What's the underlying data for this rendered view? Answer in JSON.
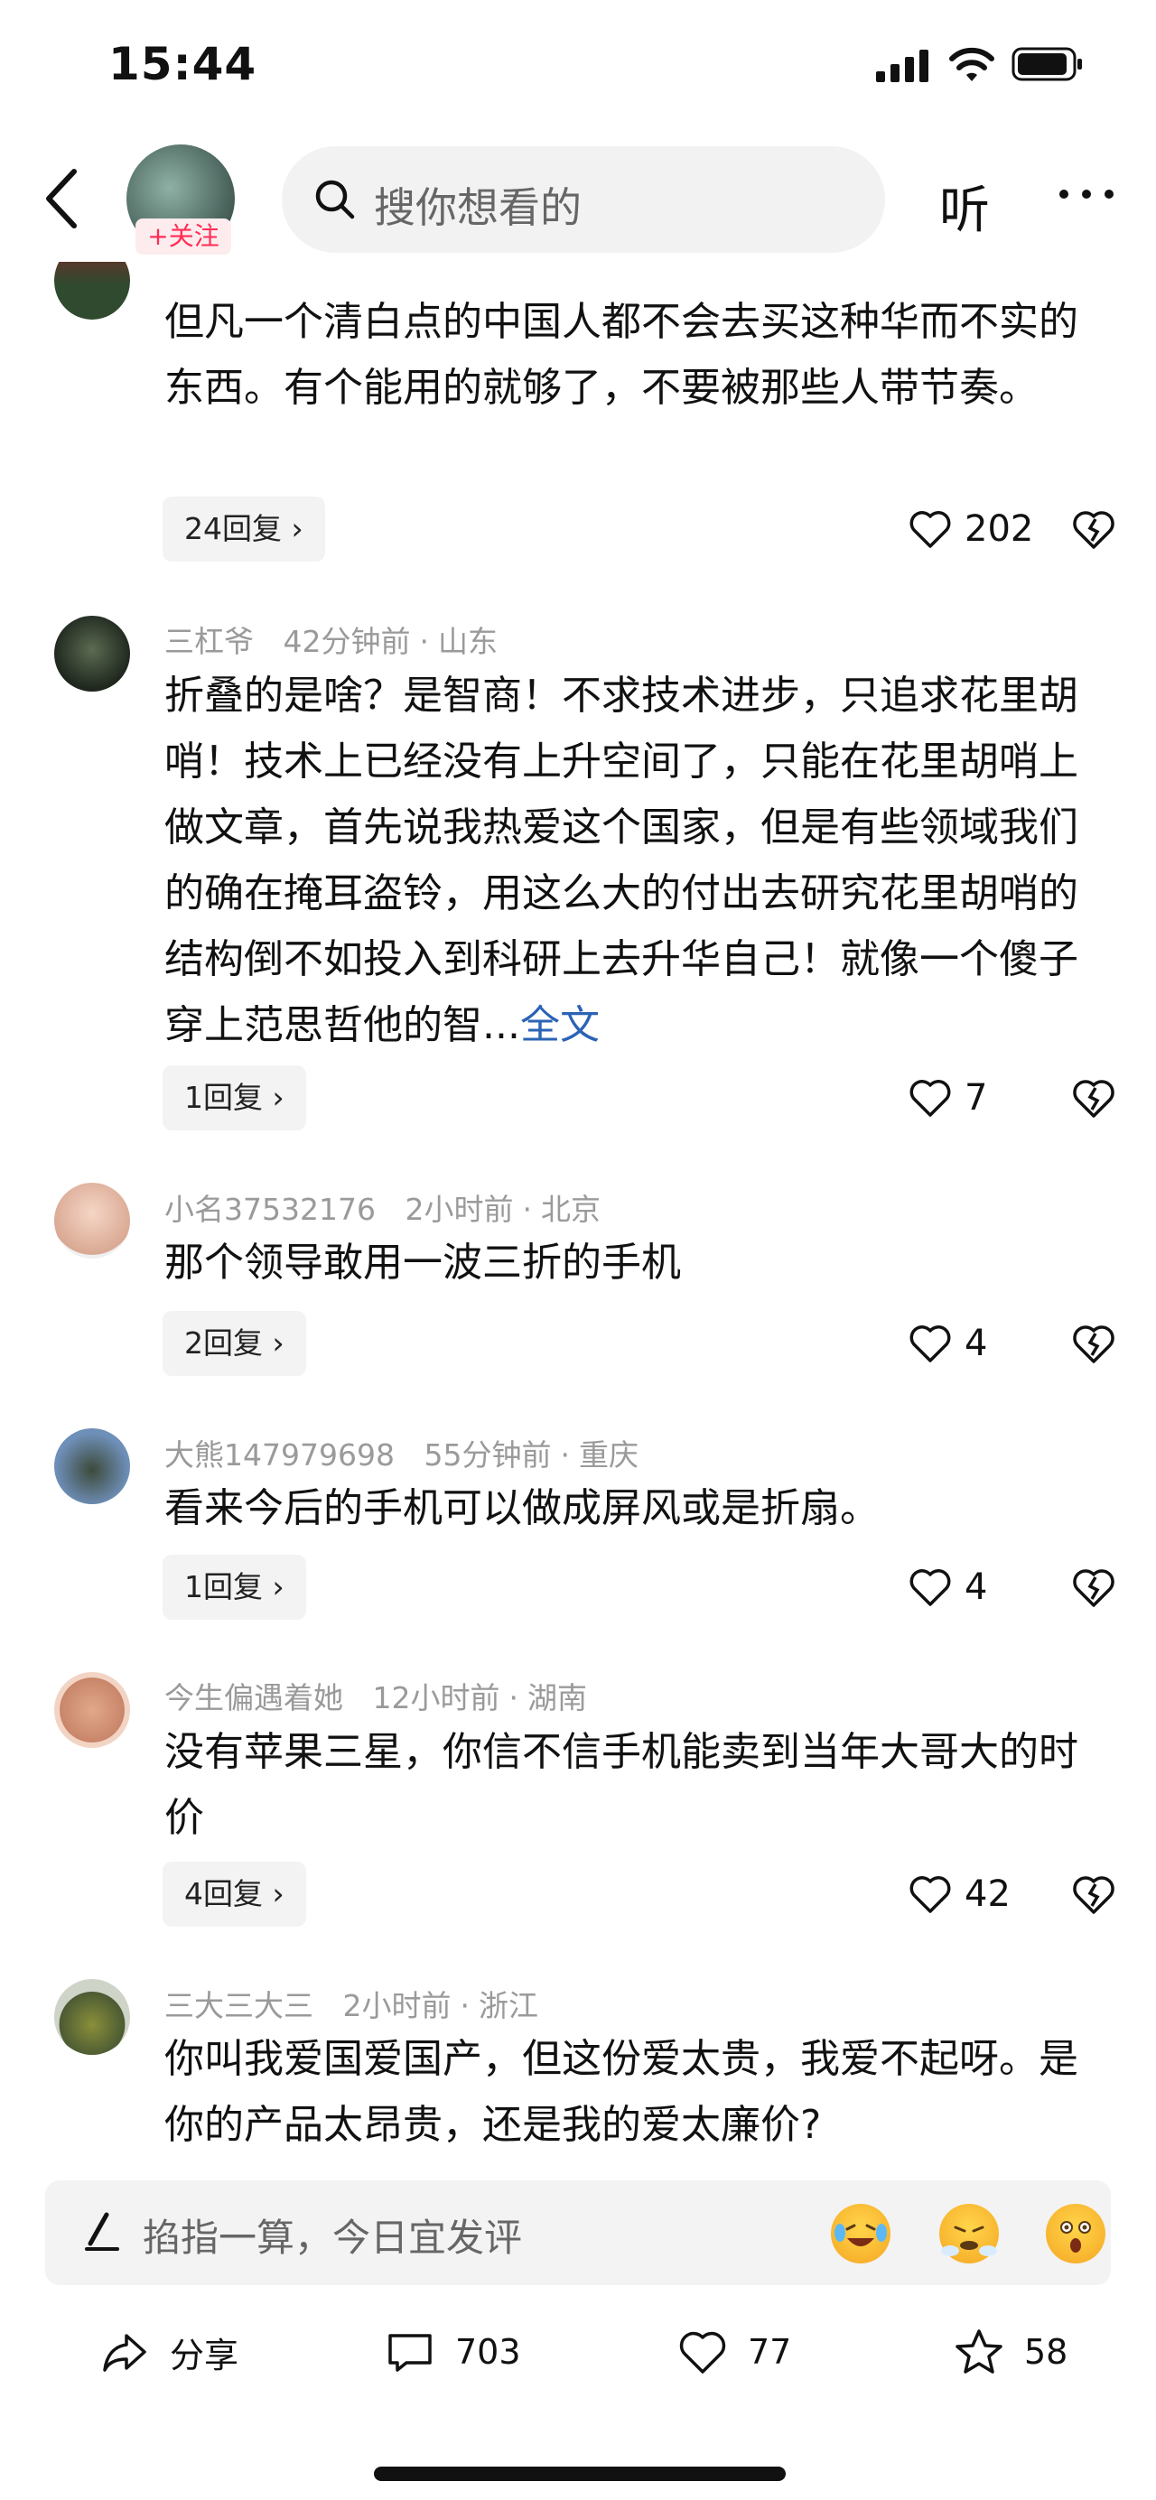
{
  "status_bar": {
    "time": "15:44"
  },
  "header": {
    "follow_label": "+关注",
    "search_placeholder": "搜你想看的",
    "listen_label": "听"
  },
  "comments": [
    {
      "meta_user": "",
      "meta_time": "",
      "meta_location": "",
      "text": "但凡一个清白点的中国人都不会去买这种华而不实的东西。有个能用的就够了，不要被那些人带节奏。",
      "more_label": "",
      "replies": "24回复",
      "likes": "202"
    },
    {
      "meta_user": "三杠爷",
      "meta_time": "42分钟前",
      "meta_location": "山东",
      "text": "折叠的是啥？是智商！不求技术进步，只追求花里胡哨！技术上已经没有上升空间了，只能在花里胡哨上做文章，首先说我热爱这个国家，但是有些领域我们的确在掩耳盗铃，用这么大的付出去研究花里胡哨的结构倒不如投入到科研上去升华自己！就像一个傻子穿上范思哲他的智...",
      "more_label": "全文",
      "replies": "1回复",
      "likes": "7"
    },
    {
      "meta_user": "小名37532176",
      "meta_time": "2小时前",
      "meta_location": "北京",
      "text": "那个领导敢用一波三折的手机",
      "more_label": "",
      "replies": "2回复",
      "likes": "4"
    },
    {
      "meta_user": "大熊147979698",
      "meta_time": "55分钟前",
      "meta_location": "重庆",
      "text": "看来今后的手机可以做成屏风或是折扇。",
      "more_label": "",
      "replies": "1回复",
      "likes": "4"
    },
    {
      "meta_user": "今生偏遇着她",
      "meta_time": "12小时前",
      "meta_location": "湖南",
      "text": "没有苹果三星，你信不信手机能卖到当年大哥大的时价",
      "more_label": "",
      "replies": "4回复",
      "likes": "42"
    },
    {
      "meta_user": "三大三大三",
      "meta_time": "2小时前",
      "meta_location": "浙江",
      "text": "你叫我爱国爱国产，但这份爱太贵，我爱不起呀。是你的产品太昂贵，还是我的爱太廉价?",
      "more_label": "",
      "replies": "",
      "likes": ""
    }
  ],
  "comment_input": {
    "placeholder": "掐指一算，今日宜发评"
  },
  "bottom_bar": {
    "share_label": "分享",
    "comments_count": "703",
    "likes_count": "77",
    "favorites_count": "58"
  },
  "icons": [
    "signal-icon",
    "wifi-icon",
    "battery-icon",
    "back-icon",
    "search-icon",
    "more-icon",
    "heart-icon",
    "dislike-icon",
    "pen-icon",
    "share-icon",
    "comment-icon",
    "star-icon"
  ],
  "colors": {
    "follow": "#ff2d55",
    "link": "#2b63b5",
    "chip_bg": "#f3f3f3"
  }
}
